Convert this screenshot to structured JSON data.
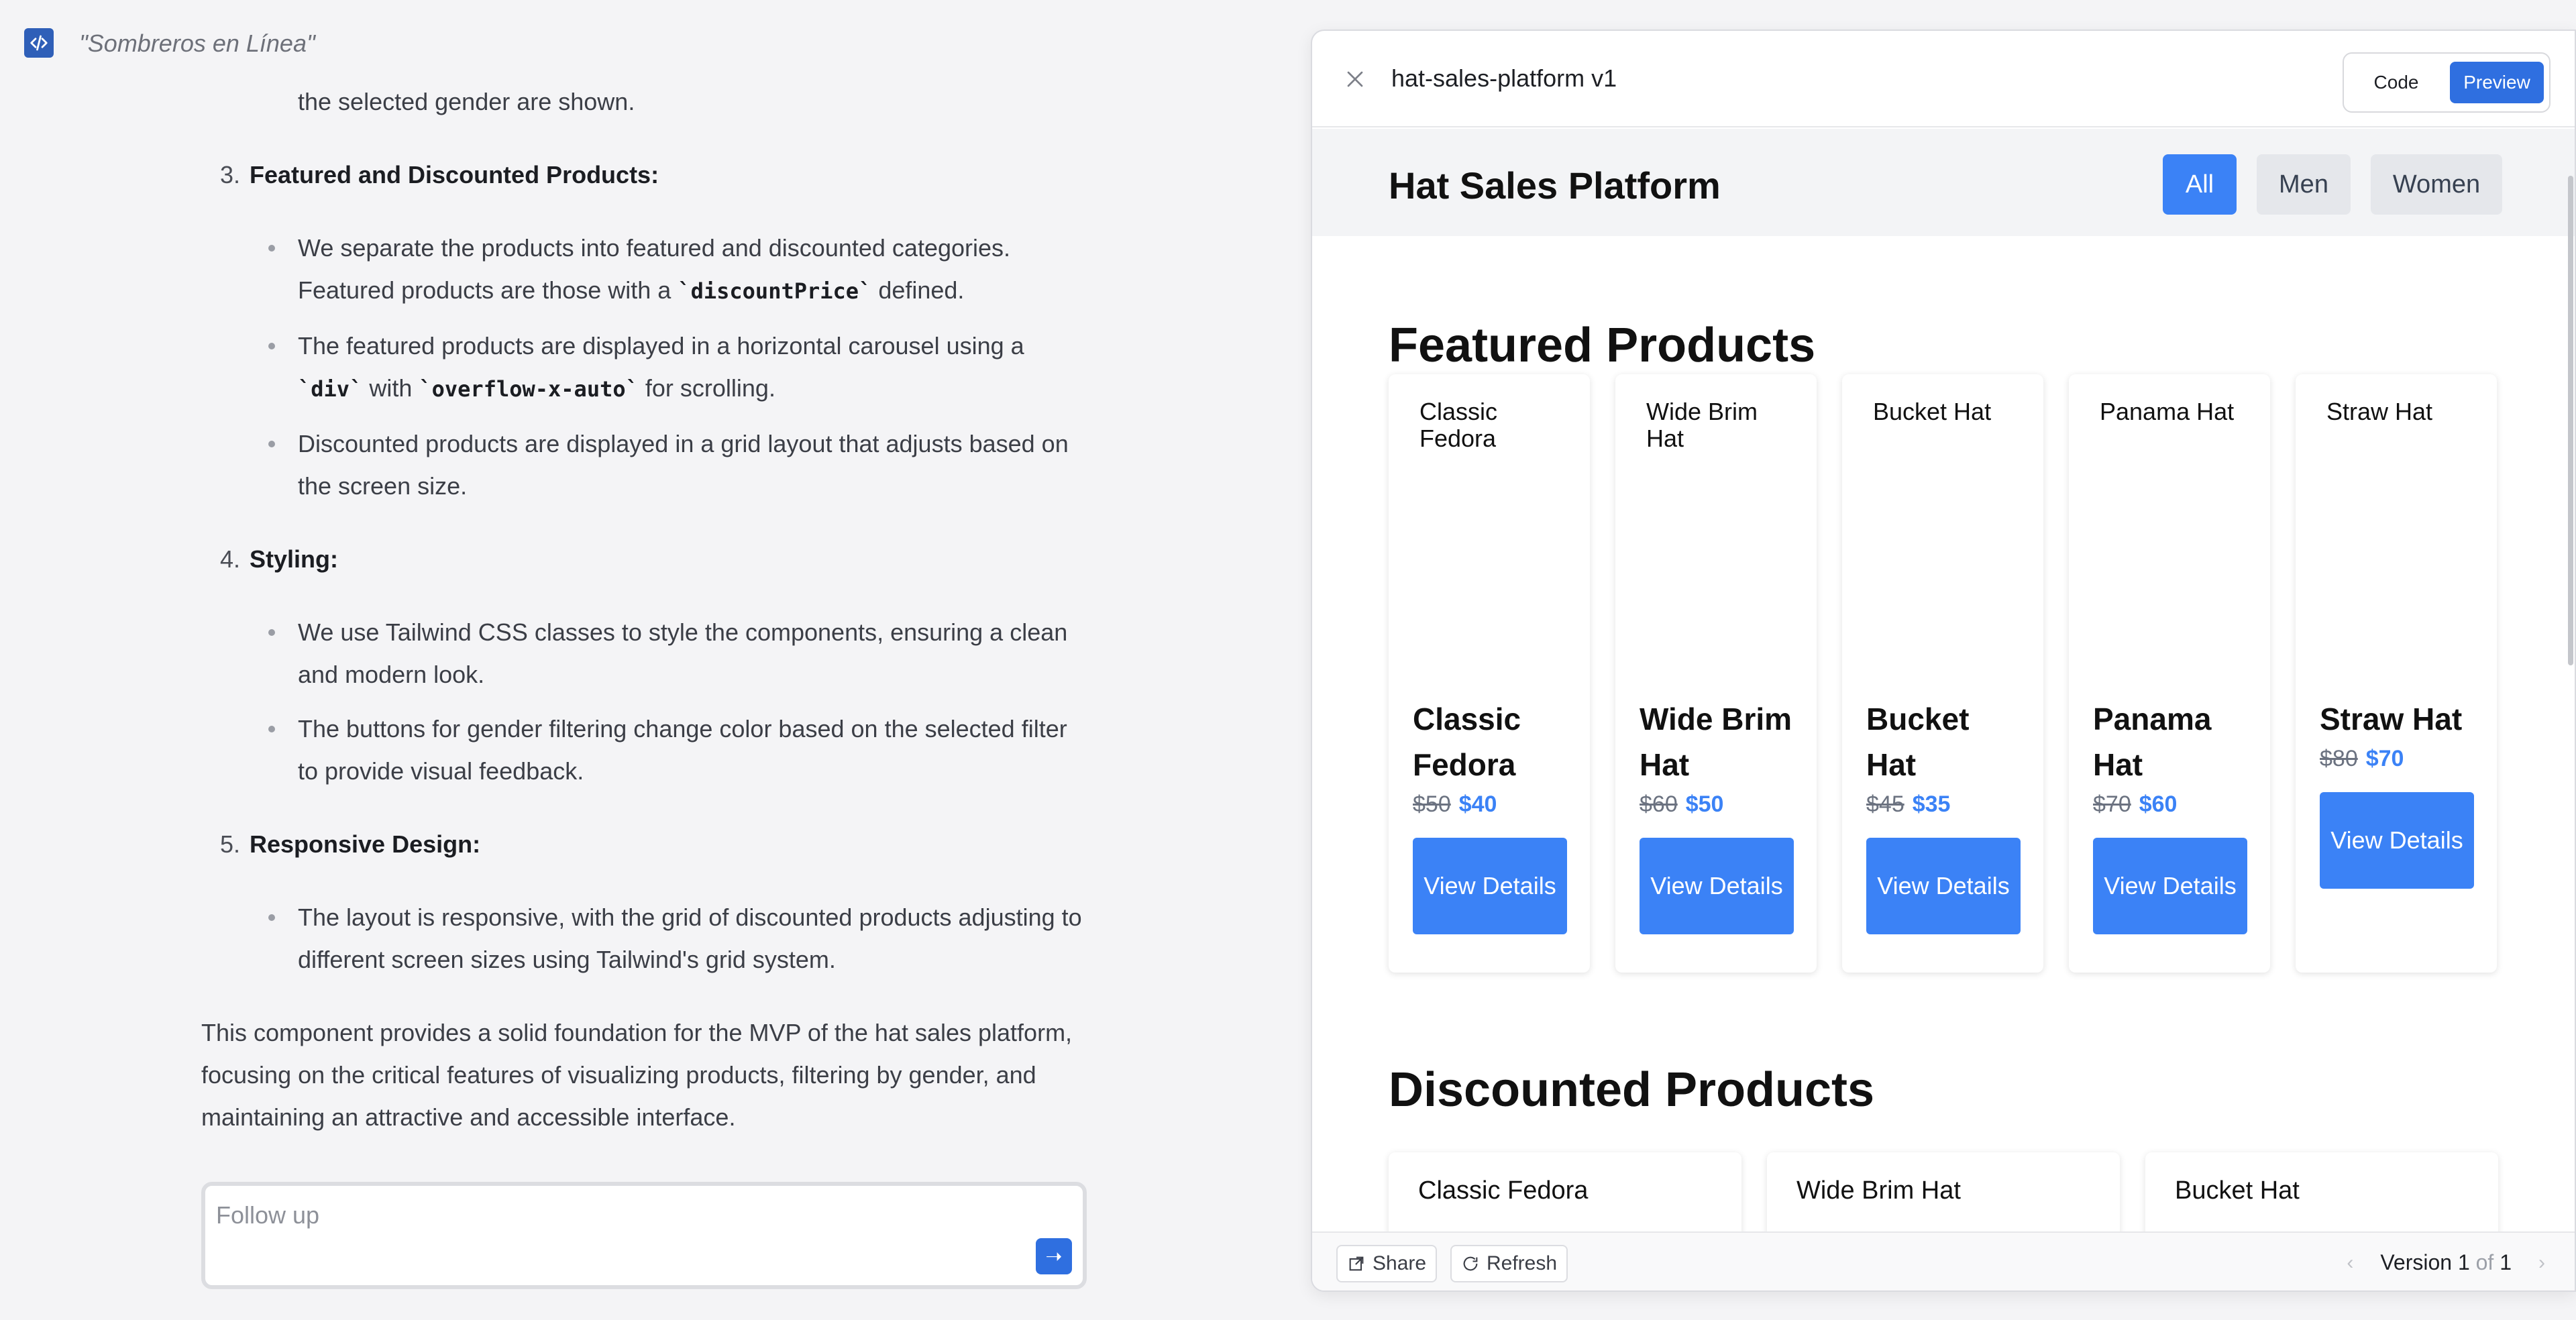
{
  "app": {
    "chat_title": "\"Sombreros en Línea\""
  },
  "chat": {
    "continuation": "the selected gender are shown.",
    "sections": [
      {
        "number": "3.",
        "heading": "Featured and Discounted Products:",
        "bullets": [
          {
            "parts": [
              "We separate the products into featured and discounted categories. Featured products are those with a ",
              "`discountPrice`",
              " defined."
            ]
          },
          {
            "parts": [
              "The featured products are displayed in a horizontal carousel using a ",
              "`div`",
              " with ",
              "`overflow-x-auto`",
              " for scrolling."
            ]
          },
          {
            "parts": [
              "Discounted products are displayed in a grid layout that adjusts based on the screen size."
            ]
          }
        ]
      },
      {
        "number": "4.",
        "heading": "Styling:",
        "bullets": [
          {
            "parts": [
              "We use Tailwind CSS classes to style the components, ensuring a clean and modern look."
            ]
          },
          {
            "parts": [
              "The buttons for gender filtering change color based on the selected filter to provide visual feedback."
            ]
          }
        ]
      },
      {
        "number": "5.",
        "heading": "Responsive Design:",
        "bullets": [
          {
            "parts": [
              "The layout is responsive, with the grid of discounted products adjusting to different screen sizes using Tailwind's grid system."
            ]
          }
        ]
      }
    ],
    "summary": "This component provides a solid foundation for the MVP of the hat sales platform, focusing on the critical features of visualizing products, filtering by gender, and maintaining an attractive and accessible interface.",
    "follow_up_placeholder": "Follow up"
  },
  "panel": {
    "title": "hat-sales-platform v1",
    "toggle": {
      "code": "Code",
      "preview": "Preview",
      "active": "Preview"
    },
    "footer": {
      "share": "Share",
      "refresh": "Refresh",
      "version_label": "Version",
      "version_current": "1",
      "version_of": "of",
      "version_total": "1"
    }
  },
  "site": {
    "title": "Hat Sales Platform",
    "filters": [
      "All",
      "Men",
      "Women"
    ],
    "active_filter": "All",
    "featured_heading": "Featured Products",
    "discounted_heading": "Discounted Products",
    "featured": [
      {
        "alt": "Classic Fedora",
        "name": "Classic Fedora",
        "old_price": "$50",
        "new_price": "$40",
        "button": "View Details"
      },
      {
        "alt": "Wide Brim Hat",
        "name": "Wide Brim Hat",
        "old_price": "$60",
        "new_price": "$50",
        "button": "View Details"
      },
      {
        "alt": "Bucket Hat",
        "name": "Bucket Hat",
        "old_price": "$45",
        "new_price": "$35",
        "button": "View Details"
      },
      {
        "alt": "Panama Hat",
        "name": "Panama Hat",
        "old_price": "$70",
        "new_price": "$60",
        "button": "View Details"
      },
      {
        "alt": "Straw Hat",
        "name": "Straw Hat",
        "old_price": "$80",
        "new_price": "$70",
        "button": "View Details"
      }
    ],
    "discounted": [
      "Classic Fedora",
      "Wide Brim Hat",
      "Bucket Hat"
    ]
  },
  "colors": {
    "accent": "#3b82f6",
    "panel_accent": "#2f6fe0",
    "logo": "#2f5fb8"
  }
}
